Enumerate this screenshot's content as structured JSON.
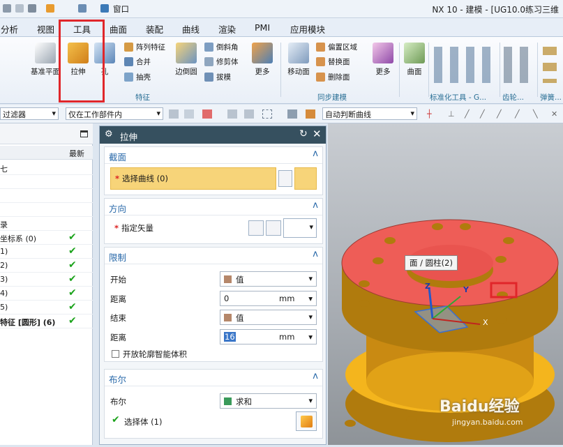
{
  "window": {
    "title": "NX 10 - 建模 - [UG10.0练习三维",
    "menu": "窗口"
  },
  "tabs": [
    "分析",
    "视图",
    "工具",
    "曲面",
    "装配",
    "曲线",
    "渲染",
    "PMI",
    "应用模块"
  ],
  "ribbon": {
    "big": [
      "基准平面",
      "拉伸",
      "孔",
      "边倒圆",
      "更多",
      "移动面",
      "更多",
      "曲面"
    ],
    "small": [
      "阵列特征",
      "合并",
      "抽壳",
      "倒斜角",
      "修剪体",
      "拔模",
      "偏置区域",
      "替换面",
      "删除面"
    ],
    "groups": [
      "特征",
      "同步建模",
      "标准化工具 - G...",
      "齿轮...",
      "弹簧..."
    ]
  },
  "selbar": {
    "filter": "过滤器",
    "scope": "仅在工作部件内",
    "curve_rule": "自动判断曲线"
  },
  "nav": {
    "col_latest": "最新",
    "rows": [
      {
        "text": "七",
        "ok": false
      },
      {
        "text": "",
        "ok": false
      },
      {
        "text": "",
        "ok": false
      },
      {
        "text": "",
        "ok": false
      },
      {
        "text": "录",
        "ok": false
      },
      {
        "text": "坐标系 (0)",
        "ok": true
      },
      {
        "text": "1)",
        "ok": true
      },
      {
        "text": "2)",
        "ok": true
      },
      {
        "text": "3)",
        "ok": true
      },
      {
        "text": "4)",
        "ok": true
      },
      {
        "text": "5)",
        "ok": true
      },
      {
        "text": "特征 [圆形] (6)",
        "ok": true
      }
    ]
  },
  "dialog": {
    "title": "拉伸",
    "section": {
      "header": "截面",
      "select_curve": "选择曲线 (0)"
    },
    "direction": {
      "header": "方向",
      "vector": "指定矢量"
    },
    "limits": {
      "header": "限制",
      "start_label": "开始",
      "start_value": "值",
      "dist1_label": "距离",
      "dist1_value": "0",
      "dist1_unit": "mm",
      "end_label": "结束",
      "end_value": "值",
      "dist2_label": "距离",
      "dist2_value": "16",
      "dist2_unit": "mm",
      "open_profile": "开放轮廓智能体积"
    },
    "boolean": {
      "header": "布尔",
      "label": "布尔",
      "value": "求和",
      "select_body": "选择体 (1)"
    }
  },
  "viewport": {
    "tooltip": "面 / 圆柱(2)",
    "axis_z": "Z",
    "axis_x": "X",
    "axis_y": "Y",
    "watermark": "Baidu经验",
    "watermark_url": "jingyan.baidu.com"
  },
  "colors": {
    "highlight": "#e0262a",
    "face_red": "#ee5d57",
    "body_orange": "#c98a12",
    "accent_blue": "#2667a8"
  }
}
